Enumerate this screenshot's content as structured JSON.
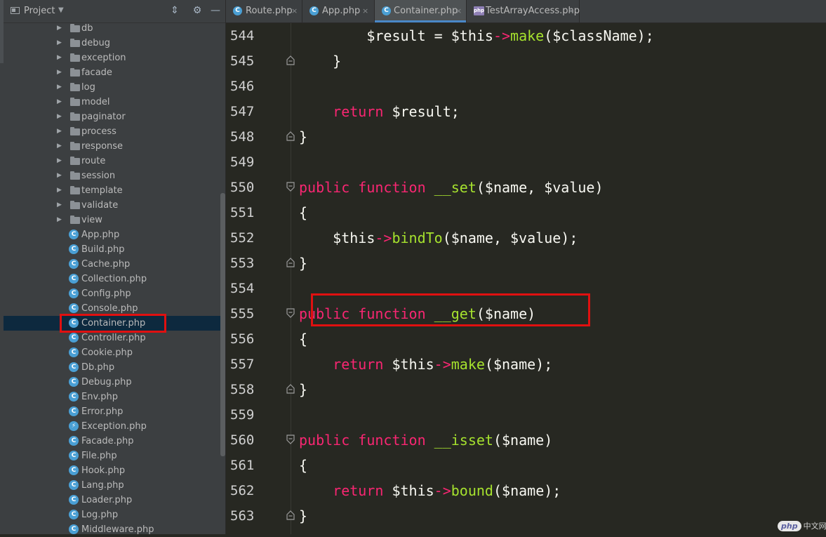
{
  "sidebar": {
    "title": "Project",
    "caret": "▼",
    "folders": [
      "db",
      "debug",
      "exception",
      "facade",
      "log",
      "model",
      "paginator",
      "process",
      "response",
      "route",
      "session",
      "template",
      "validate",
      "view"
    ],
    "files": [
      {
        "label": "App.php",
        "icon": "C"
      },
      {
        "label": "Build.php",
        "icon": "C"
      },
      {
        "label": "Cache.php",
        "icon": "C"
      },
      {
        "label": "Collection.php",
        "icon": "C"
      },
      {
        "label": "Config.php",
        "icon": "C"
      },
      {
        "label": "Console.php",
        "icon": "C"
      },
      {
        "label": "Container.php",
        "icon": "C",
        "selected": true
      },
      {
        "label": "Controller.php",
        "icon": "C"
      },
      {
        "label": "Cookie.php",
        "icon": "C"
      },
      {
        "label": "Db.php",
        "icon": "C"
      },
      {
        "label": "Debug.php",
        "icon": "C"
      },
      {
        "label": "Env.php",
        "icon": "C"
      },
      {
        "label": "Error.php",
        "icon": "C"
      },
      {
        "label": "Exception.php",
        "icon": "⚡"
      },
      {
        "label": "Facade.php",
        "icon": "C"
      },
      {
        "label": "File.php",
        "icon": "C"
      },
      {
        "label": "Hook.php",
        "icon": "C"
      },
      {
        "label": "Lang.php",
        "icon": "C"
      },
      {
        "label": "Loader.php",
        "icon": "C"
      },
      {
        "label": "Log.php",
        "icon": "C"
      },
      {
        "label": "Middleware.php",
        "icon": "C"
      }
    ]
  },
  "tabs": [
    {
      "label": "Route.php",
      "icon": "C",
      "active": false
    },
    {
      "label": "App.php",
      "icon": "C",
      "active": false
    },
    {
      "label": "Container.php",
      "icon": "C",
      "active": true
    },
    {
      "label": "TestArrayAccess.php",
      "icon": "php",
      "active": false
    }
  ],
  "tab_close": "×",
  "editor": {
    "lines": [
      {
        "num": "544",
        "fold": "",
        "tokens": [
          {
            "t": "        $result = $this",
            "c": ""
          },
          {
            "t": "->",
            "c": "kw"
          },
          {
            "t": "make",
            "c": "fn"
          },
          {
            "t": "($className);",
            "c": ""
          }
        ]
      },
      {
        "num": "545",
        "fold": "end",
        "tokens": [
          {
            "t": "    }",
            "c": ""
          }
        ]
      },
      {
        "num": "546",
        "fold": "",
        "tokens": []
      },
      {
        "num": "547",
        "fold": "",
        "tokens": [
          {
            "t": "    ",
            "c": ""
          },
          {
            "t": "return",
            "c": "kw"
          },
          {
            "t": " $result;",
            "c": ""
          }
        ]
      },
      {
        "num": "548",
        "fold": "end",
        "tokens": [
          {
            "t": "}",
            "c": ""
          }
        ]
      },
      {
        "num": "549",
        "fold": "",
        "tokens": []
      },
      {
        "num": "550",
        "fold": "start",
        "tokens": [
          {
            "t": "public",
            "c": "kw"
          },
          {
            "t": " ",
            "c": ""
          },
          {
            "t": "function",
            "c": "kw"
          },
          {
            "t": " ",
            "c": ""
          },
          {
            "t": "__set",
            "c": "fn"
          },
          {
            "t": "($name, $value)",
            "c": ""
          }
        ]
      },
      {
        "num": "551",
        "fold": "",
        "tokens": [
          {
            "t": "{",
            "c": ""
          }
        ]
      },
      {
        "num": "552",
        "fold": "",
        "tokens": [
          {
            "t": "    $this",
            "c": ""
          },
          {
            "t": "->",
            "c": "kw"
          },
          {
            "t": "bindTo",
            "c": "fn"
          },
          {
            "t": "($name, $value);",
            "c": ""
          }
        ]
      },
      {
        "num": "553",
        "fold": "end",
        "tokens": [
          {
            "t": "}",
            "c": ""
          }
        ]
      },
      {
        "num": "554",
        "fold": "",
        "tokens": []
      },
      {
        "num": "555",
        "fold": "start",
        "tokens": [
          {
            "t": "public",
            "c": "kw"
          },
          {
            "t": " ",
            "c": ""
          },
          {
            "t": "function",
            "c": "kw"
          },
          {
            "t": " ",
            "c": ""
          },
          {
            "t": "__get",
            "c": "fn"
          },
          {
            "t": "($name)",
            "c": ""
          }
        ]
      },
      {
        "num": "556",
        "fold": "",
        "tokens": [
          {
            "t": "{",
            "c": ""
          }
        ]
      },
      {
        "num": "557",
        "fold": "",
        "tokens": [
          {
            "t": "    ",
            "c": ""
          },
          {
            "t": "return",
            "c": "kw"
          },
          {
            "t": " $this",
            "c": ""
          },
          {
            "t": "->",
            "c": "kw"
          },
          {
            "t": "make",
            "c": "fn"
          },
          {
            "t": "($name);",
            "c": ""
          }
        ]
      },
      {
        "num": "558",
        "fold": "end",
        "tokens": [
          {
            "t": "}",
            "c": ""
          }
        ]
      },
      {
        "num": "559",
        "fold": "",
        "tokens": []
      },
      {
        "num": "560",
        "fold": "start",
        "tokens": [
          {
            "t": "public",
            "c": "kw"
          },
          {
            "t": " ",
            "c": ""
          },
          {
            "t": "function",
            "c": "kw"
          },
          {
            "t": " ",
            "c": ""
          },
          {
            "t": "__isset",
            "c": "fn"
          },
          {
            "t": "($name)",
            "c": ""
          }
        ]
      },
      {
        "num": "561",
        "fold": "",
        "tokens": [
          {
            "t": "{",
            "c": ""
          }
        ]
      },
      {
        "num": "562",
        "fold": "",
        "tokens": [
          {
            "t": "    ",
            "c": ""
          },
          {
            "t": "return",
            "c": "kw"
          },
          {
            "t": " $this",
            "c": ""
          },
          {
            "t": "->",
            "c": "kw"
          },
          {
            "t": "bound",
            "c": "fn"
          },
          {
            "t": "($name);",
            "c": ""
          }
        ]
      },
      {
        "num": "563",
        "fold": "end",
        "tokens": [
          {
            "t": "}",
            "c": ""
          }
        ]
      }
    ]
  },
  "watermark": {
    "badge": "php",
    "text": "中文网"
  },
  "colors": {
    "keyword": "#f92672",
    "function": "#a6e22e",
    "highlight": "#e01010",
    "selection": "#0d293e",
    "accent": "#4a88c7"
  }
}
